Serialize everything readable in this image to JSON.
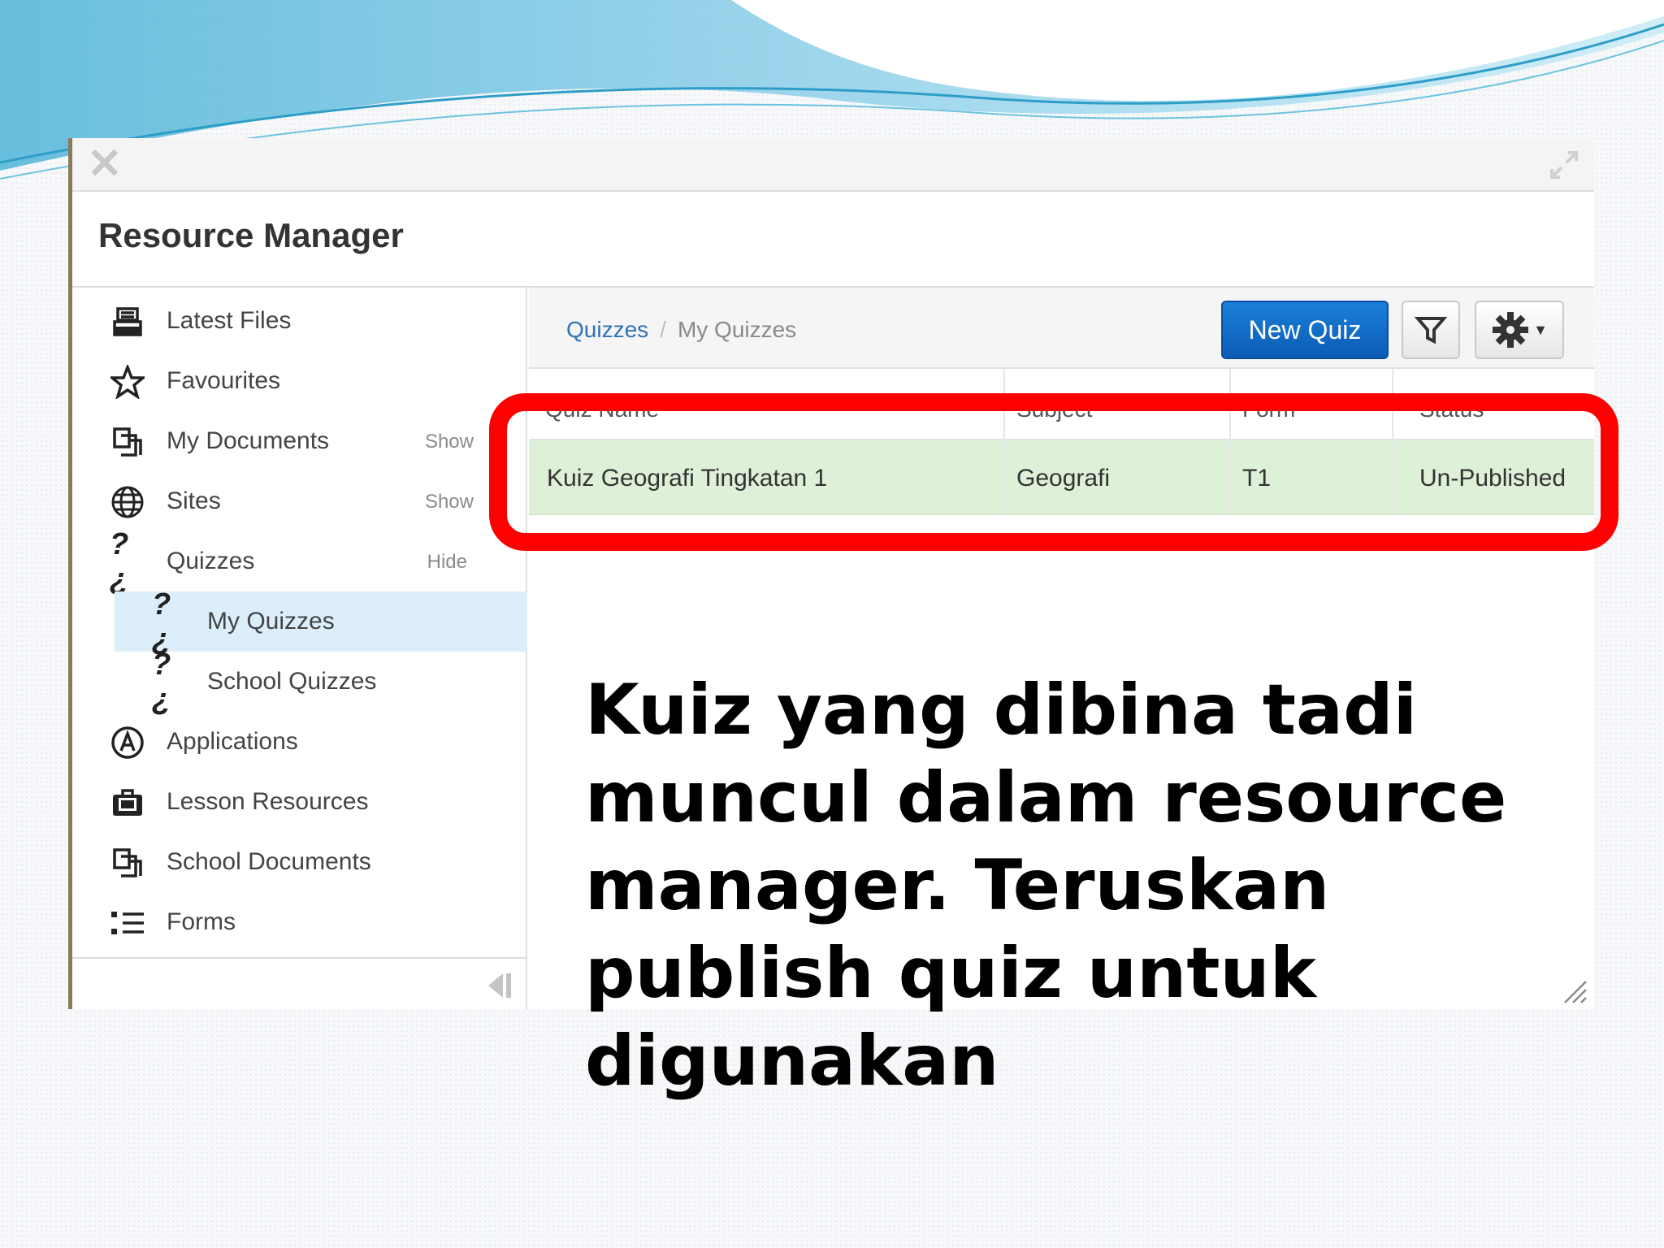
{
  "window": {
    "title": "Resource Manager"
  },
  "sidebar": {
    "items": [
      {
        "label": "Latest Files",
        "icon": "inbox-tray-icon",
        "action": ""
      },
      {
        "label": "Favourites",
        "icon": "star-icon",
        "action": ""
      },
      {
        "label": "My Documents",
        "icon": "documents-icon",
        "action": "Show"
      },
      {
        "label": "Sites",
        "icon": "globe-icon",
        "action": "Show"
      },
      {
        "label": "Quizzes",
        "icon": "quiz-icon",
        "action": "Hide"
      },
      {
        "label": "My Quizzes",
        "icon": "quiz-icon",
        "action": ""
      },
      {
        "label": "School Quizzes",
        "icon": "quiz-icon",
        "action": ""
      },
      {
        "label": "Applications",
        "icon": "applications-icon",
        "action": ""
      },
      {
        "label": "Lesson Resources",
        "icon": "briefcase-icon",
        "action": ""
      },
      {
        "label": "School Documents",
        "icon": "documents-icon",
        "action": ""
      },
      {
        "label": "Forms",
        "icon": "list-icon",
        "action": ""
      }
    ]
  },
  "breadcrumb": {
    "root": "Quizzes",
    "sep": "/",
    "current": "My Quizzes"
  },
  "toolbar": {
    "new_quiz": "New Quiz"
  },
  "table": {
    "headers": [
      "Quiz Name",
      "Subject",
      "Form",
      "Status"
    ],
    "rows": [
      {
        "name": "Kuiz Geografi Tingkatan 1",
        "subject": "Geografi",
        "form": "T1",
        "status": "Un-Published"
      }
    ]
  },
  "caption": "Kuiz yang dibina tadi muncul dalam resource manager. Teruskan publish quiz untuk digunakan",
  "colors": {
    "accent": "#0b5cb5",
    "highlight": "#ff0000",
    "row_bg": "#dff0d8",
    "active_bg": "#dbeefa"
  }
}
